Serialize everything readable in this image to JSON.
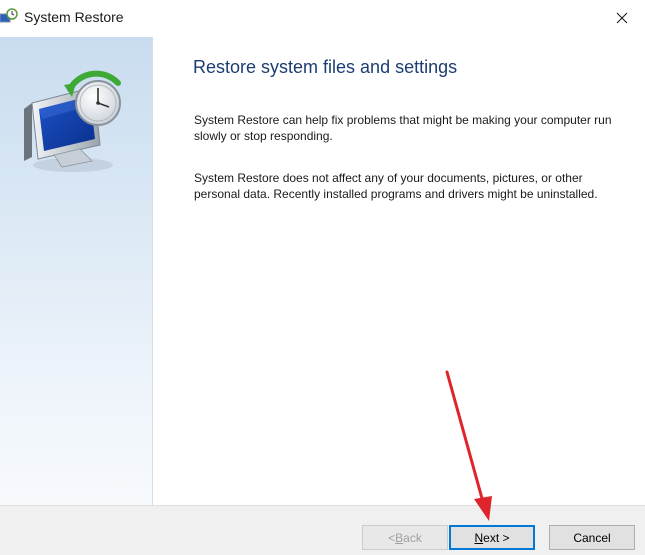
{
  "window": {
    "title": "System Restore",
    "icon": "system-restore-icon",
    "close_glyph": "✕"
  },
  "sidebar": {
    "illustration": "computer-with-clock-icon"
  },
  "main": {
    "heading": "Restore system files and settings",
    "paragraphs": [
      "System Restore can help fix problems that might be making your computer run slowly or stop responding.",
      "System Restore does not affect any of your documents, pictures, or other personal data. Recently installed programs and drivers might be uninstalled."
    ]
  },
  "footer": {
    "back": {
      "accel": "B",
      "prefix": "< ",
      "rest": "ack",
      "enabled": false
    },
    "next": {
      "accel": "N",
      "rest": "ext >",
      "enabled": true
    },
    "cancel": {
      "label": "Cancel",
      "enabled": true
    }
  },
  "annotation": {
    "type": "arrow",
    "color": "#e0242b",
    "points_to": "next-button"
  },
  "colors": {
    "heading": "#1c3d72",
    "accent_border": "#0078d7",
    "sidebar_top": "#c9dcef",
    "footer_bg": "#f0f0f0"
  }
}
